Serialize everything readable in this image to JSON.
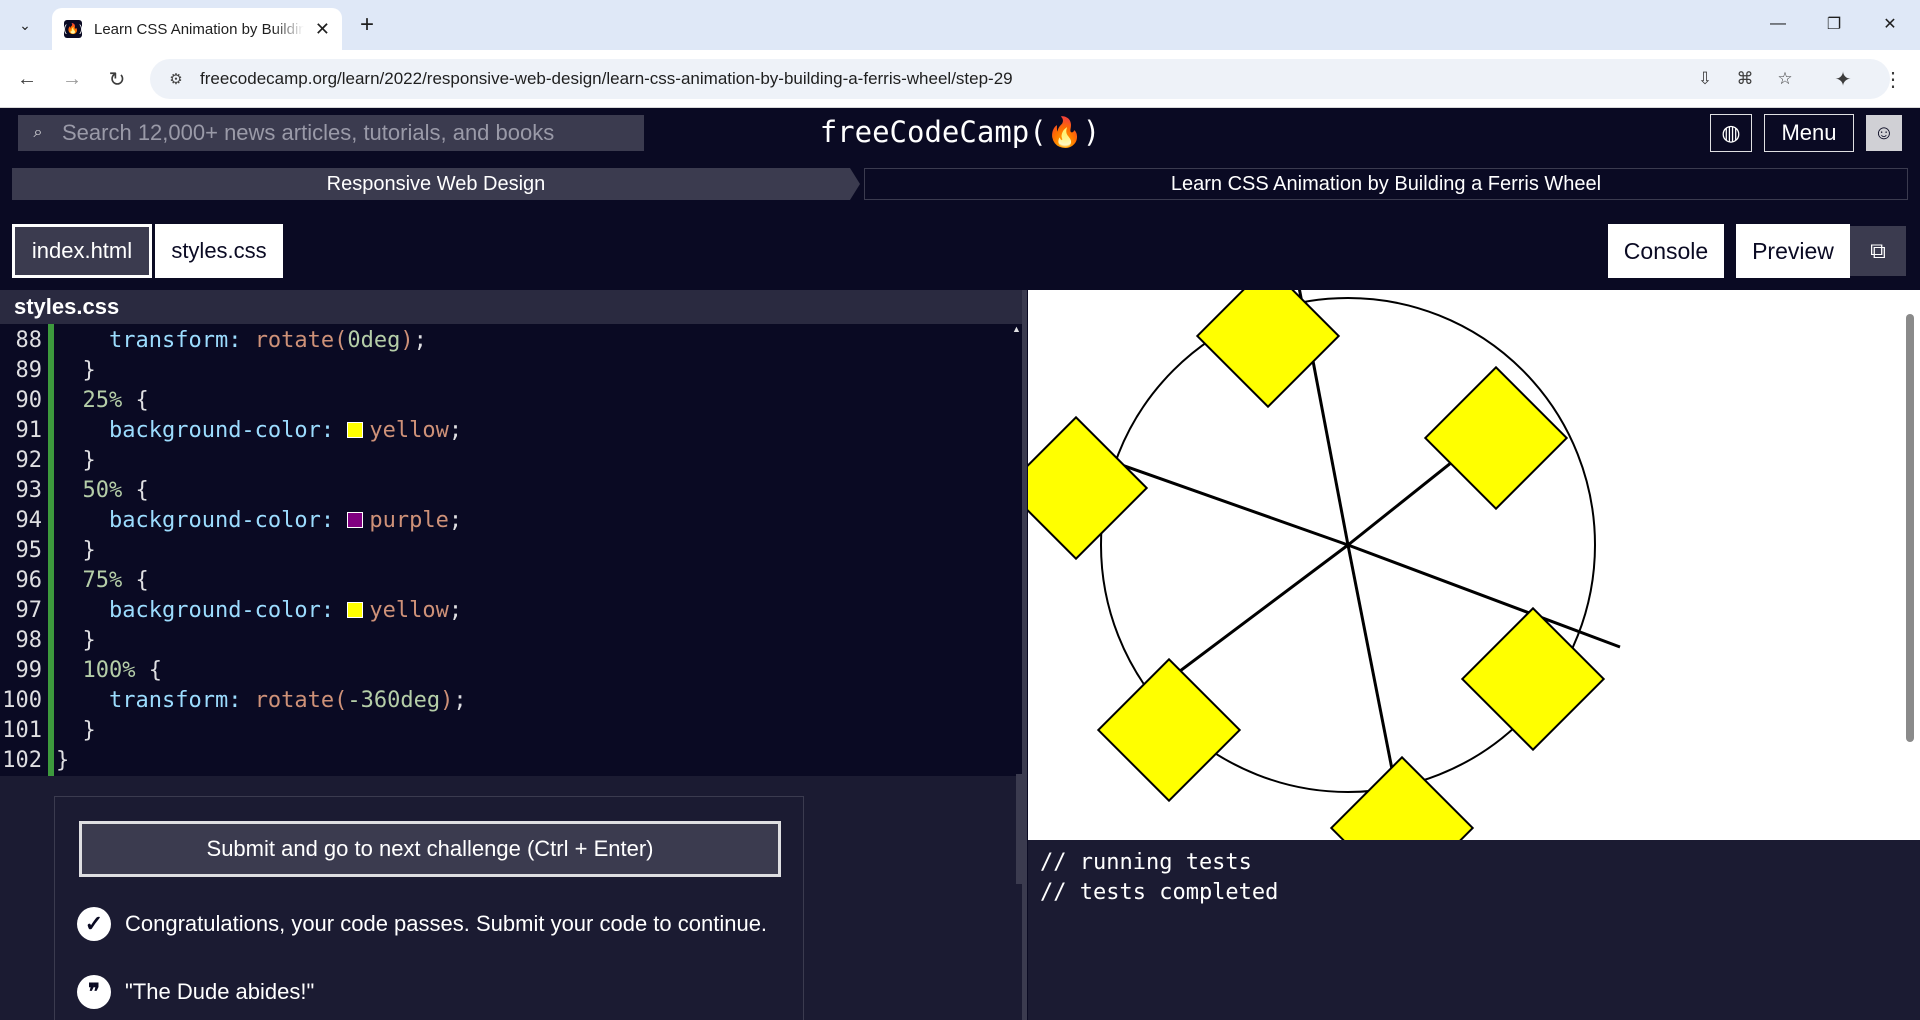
{
  "browser": {
    "tab_title": "Learn CSS Animation by Building a Ferris Wheel",
    "url": "freecodecamp.org/learn/2022/responsive-web-design/learn-css-animation-by-building-a-ferris-wheel/step-29"
  },
  "nav": {
    "search_placeholder": "Search 12,000+ news articles, tutorials, and books",
    "logo": "freeCodeCamp(🔥)",
    "menu_label": "Menu"
  },
  "breadcrumb": {
    "superblock": "Responsive Web Design",
    "block": "Learn CSS Animation by Building a Ferris Wheel"
  },
  "file_tabs": {
    "html": "index.html",
    "css": "styles.css"
  },
  "pane_buttons": {
    "console": "Console",
    "preview": "Preview"
  },
  "editor": {
    "header": "styles.css",
    "lines": [
      {
        "n": "88",
        "indent": "  ",
        "prop": "transform:",
        "fn": "rotate(",
        "val": "0deg",
        "end": ");"
      },
      {
        "n": "89",
        "text": "}"
      },
      {
        "n": "90",
        "sel": "25%",
        "brace": " {"
      },
      {
        "n": "91",
        "indent": "  ",
        "prop": "background-color:",
        "color": "yellow",
        "end": ";"
      },
      {
        "n": "92",
        "text": "}"
      },
      {
        "n": "93",
        "sel": "50%",
        "brace": " {"
      },
      {
        "n": "94",
        "indent": "  ",
        "prop": "background-color:",
        "color": "purple",
        "end": ";"
      },
      {
        "n": "95",
        "text": "}"
      },
      {
        "n": "96",
        "sel": "75%",
        "brace": " {"
      },
      {
        "n": "97",
        "indent": "  ",
        "prop": "background-color:",
        "color": "yellow",
        "end": ";"
      },
      {
        "n": "98",
        "text": "}"
      },
      {
        "n": "99",
        "sel": "100%",
        "brace": " {"
      },
      {
        "n": "100",
        "indent": "  ",
        "prop": "transform:",
        "fn": "rotate(",
        "val": "-360deg",
        "end": ");"
      },
      {
        "n": "101",
        "text": "}"
      },
      {
        "n": "102",
        "text": "}"
      }
    ]
  },
  "tests": {
    "submit_label": "Submit and go to next challenge (Ctrl + Enter)",
    "pass_message": "Congratulations, your code passes. Submit your code to continue.",
    "quote": "\"The Dude abides!\""
  },
  "console": {
    "lines": [
      "// running tests",
      "// tests completed"
    ]
  },
  "colors": {
    "accent_bg": "#0a0a23",
    "cabin_fill": "#ffff00",
    "swatch_yellow": "#ffff00",
    "swatch_purple": "#800080"
  }
}
